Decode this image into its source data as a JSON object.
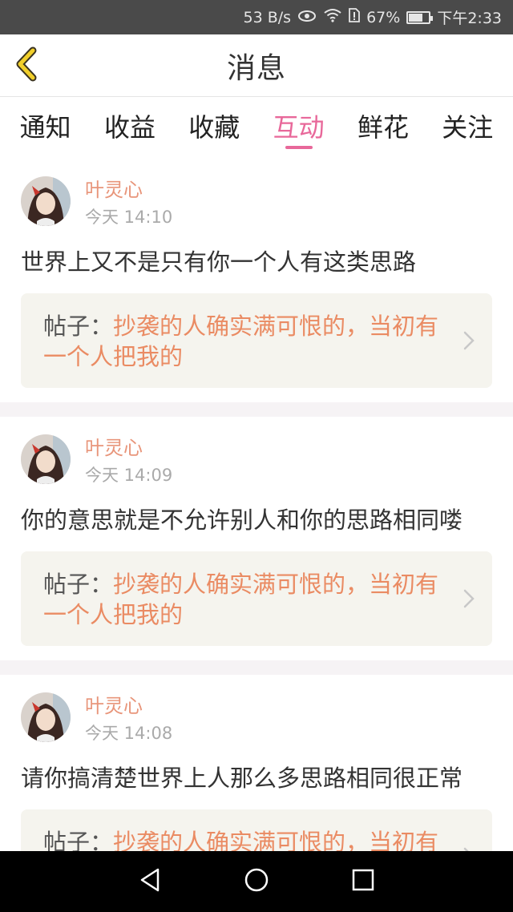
{
  "status_bar": {
    "net_speed": "53 B/s",
    "battery_pct": "67%",
    "time": "下午2:33",
    "icons": [
      "eye-icon",
      "wifi-icon",
      "sim-alert-icon",
      "battery-icon"
    ]
  },
  "header": {
    "title": "消息",
    "back_icon": "chevron-left-icon"
  },
  "tabs": [
    {
      "label": "通知",
      "active": false
    },
    {
      "label": "收益",
      "active": false
    },
    {
      "label": "收藏",
      "active": false
    },
    {
      "label": "互动",
      "active": true
    },
    {
      "label": "鲜花",
      "active": false
    },
    {
      "label": "关注",
      "active": false
    }
  ],
  "messages": [
    {
      "user": "叶灵心",
      "time": "今天 14:10",
      "text": "世界上又不是只有你一个人有这类思路",
      "post_prefix": "帖子：",
      "post_title": "抄袭的人确实满可恨的，当初有一个人把我的"
    },
    {
      "user": "叶灵心",
      "time": "今天 14:09",
      "text": "你的意思就是不允许别人和你的思路相同喽",
      "post_prefix": "帖子：",
      "post_title": "抄袭的人确实满可恨的，当初有一个人把我的"
    },
    {
      "user": "叶灵心",
      "time": "今天 14:08",
      "text": "请你搞清楚世界上人那么多思路相同很正常",
      "post_prefix": "帖子：",
      "post_title": "抄袭的人确实满可恨的，当初有一个人把我的"
    }
  ],
  "colors": {
    "accent": "#e8689a",
    "username": "#e8957a",
    "post_title": "#ea8b63",
    "post_box_bg": "#f5f4ee",
    "status_bar_bg": "#4a4a4a",
    "back_icon": "#e6b800"
  },
  "nav_bar": {
    "icons": [
      "back-triangle-icon",
      "home-circle-icon",
      "recents-square-icon"
    ]
  }
}
